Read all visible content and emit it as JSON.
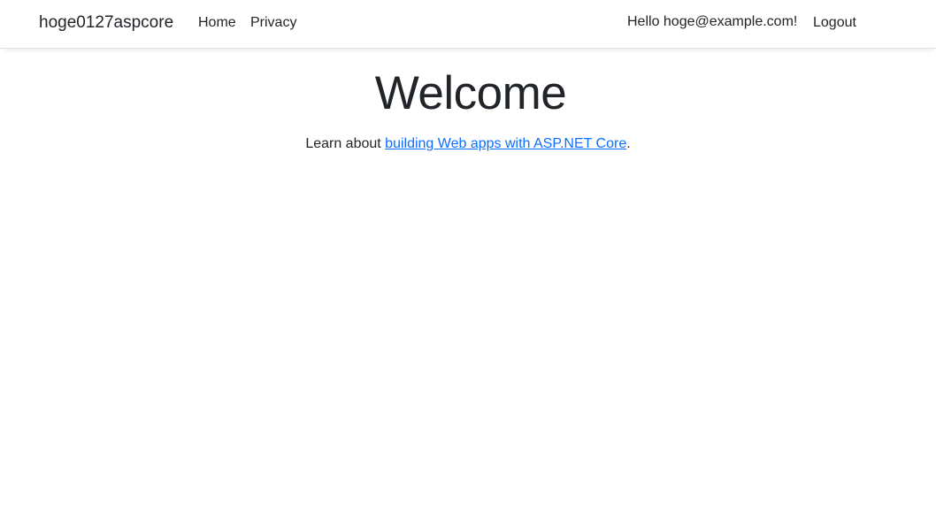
{
  "header": {
    "brand": "hoge0127aspcore",
    "nav": {
      "home": "Home",
      "privacy": "Privacy"
    },
    "greeting": "Hello hoge@example.com!",
    "logout": "Logout"
  },
  "main": {
    "title": "Welcome",
    "learn_prefix": "Learn about ",
    "learn_link": "building Web apps with ASP.NET Core",
    "learn_suffix": "."
  },
  "colors": {
    "link": "#0d6efd",
    "text": "#212529"
  }
}
